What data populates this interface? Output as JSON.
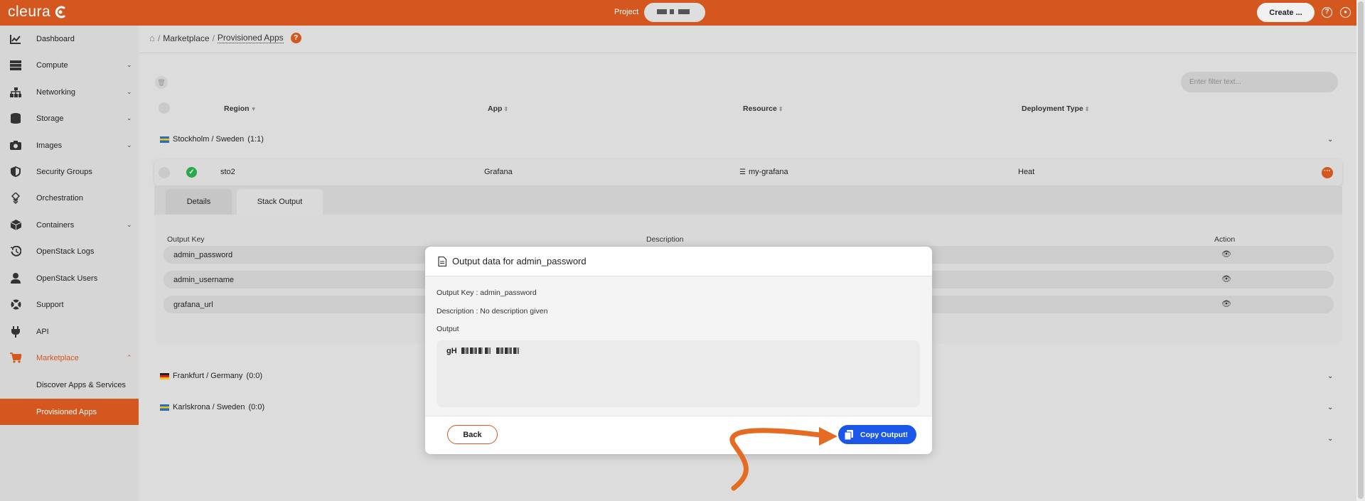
{
  "topbar": {
    "logo_text": "cleura",
    "project_label": "Project",
    "create_label": "Create ...",
    "help_glyph": "?",
    "user_glyph": "●",
    "accent_color": "#d4571f"
  },
  "sidebar": {
    "items": [
      {
        "label": "Dashboard",
        "icon": "chart-icon"
      },
      {
        "label": "Compute",
        "icon": "server-icon"
      },
      {
        "label": "Networking",
        "icon": "network-icon"
      },
      {
        "label": "Storage",
        "icon": "database-icon"
      },
      {
        "label": "Images",
        "icon": "camera-icon"
      },
      {
        "label": "Security Groups",
        "icon": "shield-icon"
      },
      {
        "label": "Orchestration",
        "icon": "orchestration-icon"
      },
      {
        "label": "Containers",
        "icon": "cube-icon"
      },
      {
        "label": "OpenStack Logs",
        "icon": "history-icon"
      },
      {
        "label": "OpenStack Users",
        "icon": "user-icon"
      },
      {
        "label": "Support",
        "icon": "lifebuoy-icon"
      },
      {
        "label": "API",
        "icon": "plug-icon"
      },
      {
        "label": "Marketplace",
        "icon": "cart-icon"
      },
      {
        "label": "Discover Apps & Services"
      },
      {
        "label": "Provisioned Apps"
      }
    ]
  },
  "breadcrumb": {
    "home_glyph": "⌂",
    "sep": "/",
    "marketplace": "Marketplace",
    "current": "Provisioned Apps",
    "help_glyph": "?"
  },
  "toolbar": {
    "filter_placeholder": "Enter filter text..."
  },
  "table": {
    "headers": {
      "region": "Region",
      "app": "App",
      "resource": "Resource",
      "deployment_type": "Deployment Type"
    },
    "groups": [
      {
        "name": "Stockholm / Sweden",
        "count": "(1:1)"
      },
      {
        "name": "Frankfurt / Germany",
        "count": "(0:0)"
      },
      {
        "name": "Karlskrona / Sweden",
        "count": "(0:0)"
      }
    ],
    "row": {
      "region": "sto2",
      "app": "Grafana",
      "resource": "my-grafana",
      "deployment_type": "Heat",
      "status": "success"
    }
  },
  "details": {
    "tabs": [
      "Details",
      "Stack Output"
    ],
    "selected_tab": "Stack Output",
    "columns": {
      "key": "Output Key",
      "description": "Description",
      "action": "Action"
    },
    "outputs": [
      "admin_password",
      "admin_username",
      "grafana_url"
    ]
  },
  "modal": {
    "title": "Output data for admin_password",
    "output_key_line": "Output Key : admin_password",
    "description_line": "Description : No description given",
    "output_label": "Output",
    "output_value_prefix": "gH",
    "back_label": "Back",
    "copy_label": "Copy Output!",
    "copy_color": "#1a56e8"
  }
}
